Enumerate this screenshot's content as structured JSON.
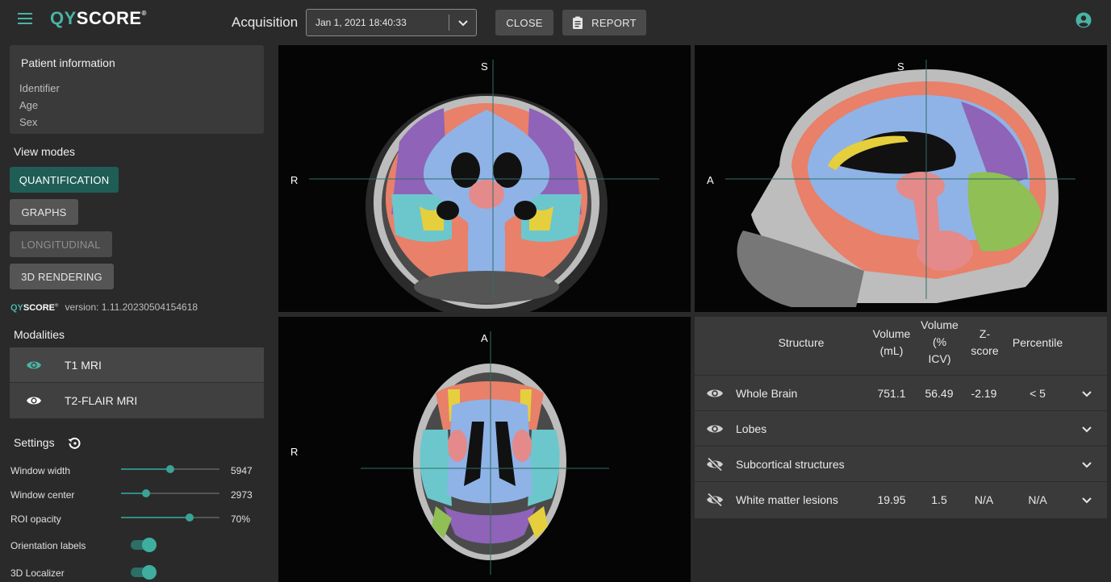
{
  "header": {
    "logo_q": "QY",
    "logo_rest": "SCORE",
    "logo_mark": "®",
    "acquisition_label": "Acquisition",
    "acquisition_value": "Jan 1, 2021 18:40:33",
    "close_label": "CLOSE",
    "report_label": "REPORT"
  },
  "patient": {
    "title": "Patient information",
    "fields": [
      "Identifier",
      "Age",
      "Sex"
    ]
  },
  "view_modes": {
    "title": "View modes",
    "buttons": [
      "QUANTIFICATION",
      "GRAPHS",
      "LONGITUDINAL",
      "3D RENDERING"
    ]
  },
  "version": {
    "logo_q": "QY",
    "logo_rest": "SCORE",
    "logo_mark": "®",
    "text": "version: 1.11.20230504154618"
  },
  "modalities": {
    "title": "Modalities",
    "items": [
      "T1 MRI",
      "T2-FLAIR MRI"
    ]
  },
  "settings": {
    "title": "Settings",
    "sliders": [
      {
        "label": "Window width",
        "value": "5947",
        "fraction": 0.5
      },
      {
        "label": "Window center",
        "value": "2973",
        "fraction": 0.25
      },
      {
        "label": "ROI opacity",
        "value": "70%",
        "fraction": 0.7
      }
    ],
    "toggles": [
      {
        "label": "Orientation labels",
        "on": true
      },
      {
        "label": "3D Localizer",
        "on": true
      }
    ]
  },
  "viewers": {
    "coronal": {
      "top": "S",
      "left": "R"
    },
    "sagittal": {
      "top": "S",
      "left": "A"
    },
    "axial": {
      "top": "A",
      "left": "R"
    }
  },
  "table": {
    "headers": {
      "structure": "Structure",
      "volume_ml_1": "Volume",
      "volume_ml_2": "(mL)",
      "volume_icv_1": "Volume",
      "volume_icv_2": "(%",
      "volume_icv_3": "ICV)",
      "zscore_1": "Z-",
      "zscore_2": "score",
      "percentile": "Percentile"
    },
    "rows": [
      {
        "name": "Whole Brain",
        "volume": "751.1",
        "icv": "56.49",
        "z": "-2.19",
        "pct": "< 5",
        "visible": true
      },
      {
        "name": "Lobes",
        "volume": "",
        "icv": "",
        "z": "",
        "pct": "",
        "visible": true
      },
      {
        "name": "Subcortical structures",
        "volume": "",
        "icv": "",
        "z": "",
        "pct": "",
        "visible": false
      },
      {
        "name": "White matter lesions",
        "volume": "19.95",
        "icv": "1.5",
        "z": "N/A",
        "pct": "N/A",
        "visible": false
      }
    ]
  },
  "colors": {
    "accent": "#4ab3a4",
    "active_button": "#1f5e56",
    "wm": "#8fb3e6",
    "gm_frontal": "#e8806a",
    "gm_temporal": "#6cc7cc",
    "gm_parietal": "#e6cf3c",
    "gm_occipital": "#8e63b8",
    "cerebellum": "#e48a8a",
    "limbic": "#8fbf55"
  }
}
